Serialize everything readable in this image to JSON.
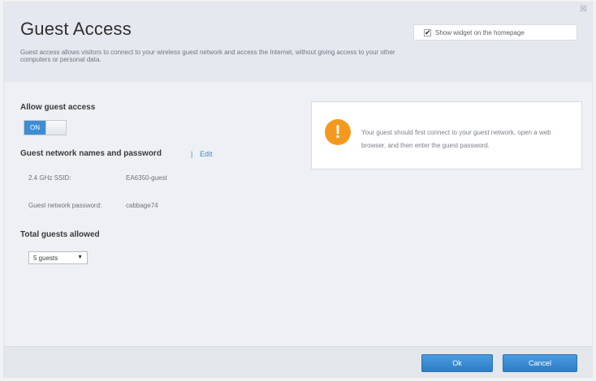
{
  "header": {
    "title": "Guest Access",
    "description": "Guest access allows visitors to connect to your wireless guest network and access the Internet, without giving access to your other computers or personal data.",
    "widget_checkbox_label": "Show widget on the homepage",
    "widget_checked": true
  },
  "allow_guest_access": {
    "label": "Allow guest access",
    "toggle_state": "ON"
  },
  "guest_network": {
    "label": "Guest network names and password",
    "separator": "|",
    "edit_label": "Edit",
    "ssid_label": "2.4 GHz SSID:",
    "ssid_value": "EA6350-guest",
    "password_label": "Guest network password:",
    "password_value": "cabbage74"
  },
  "total_guests": {
    "label": "Total guests allowed",
    "selected": "5 guests"
  },
  "note": {
    "text": "Your guest should first connect to your guest network, open a web browser, and then enter the guest password."
  },
  "footer": {
    "ok_label": "Ok",
    "cancel_label": "Cancel"
  },
  "colors": {
    "accent": "#3d8dd2",
    "warning": "#f39a1e"
  }
}
